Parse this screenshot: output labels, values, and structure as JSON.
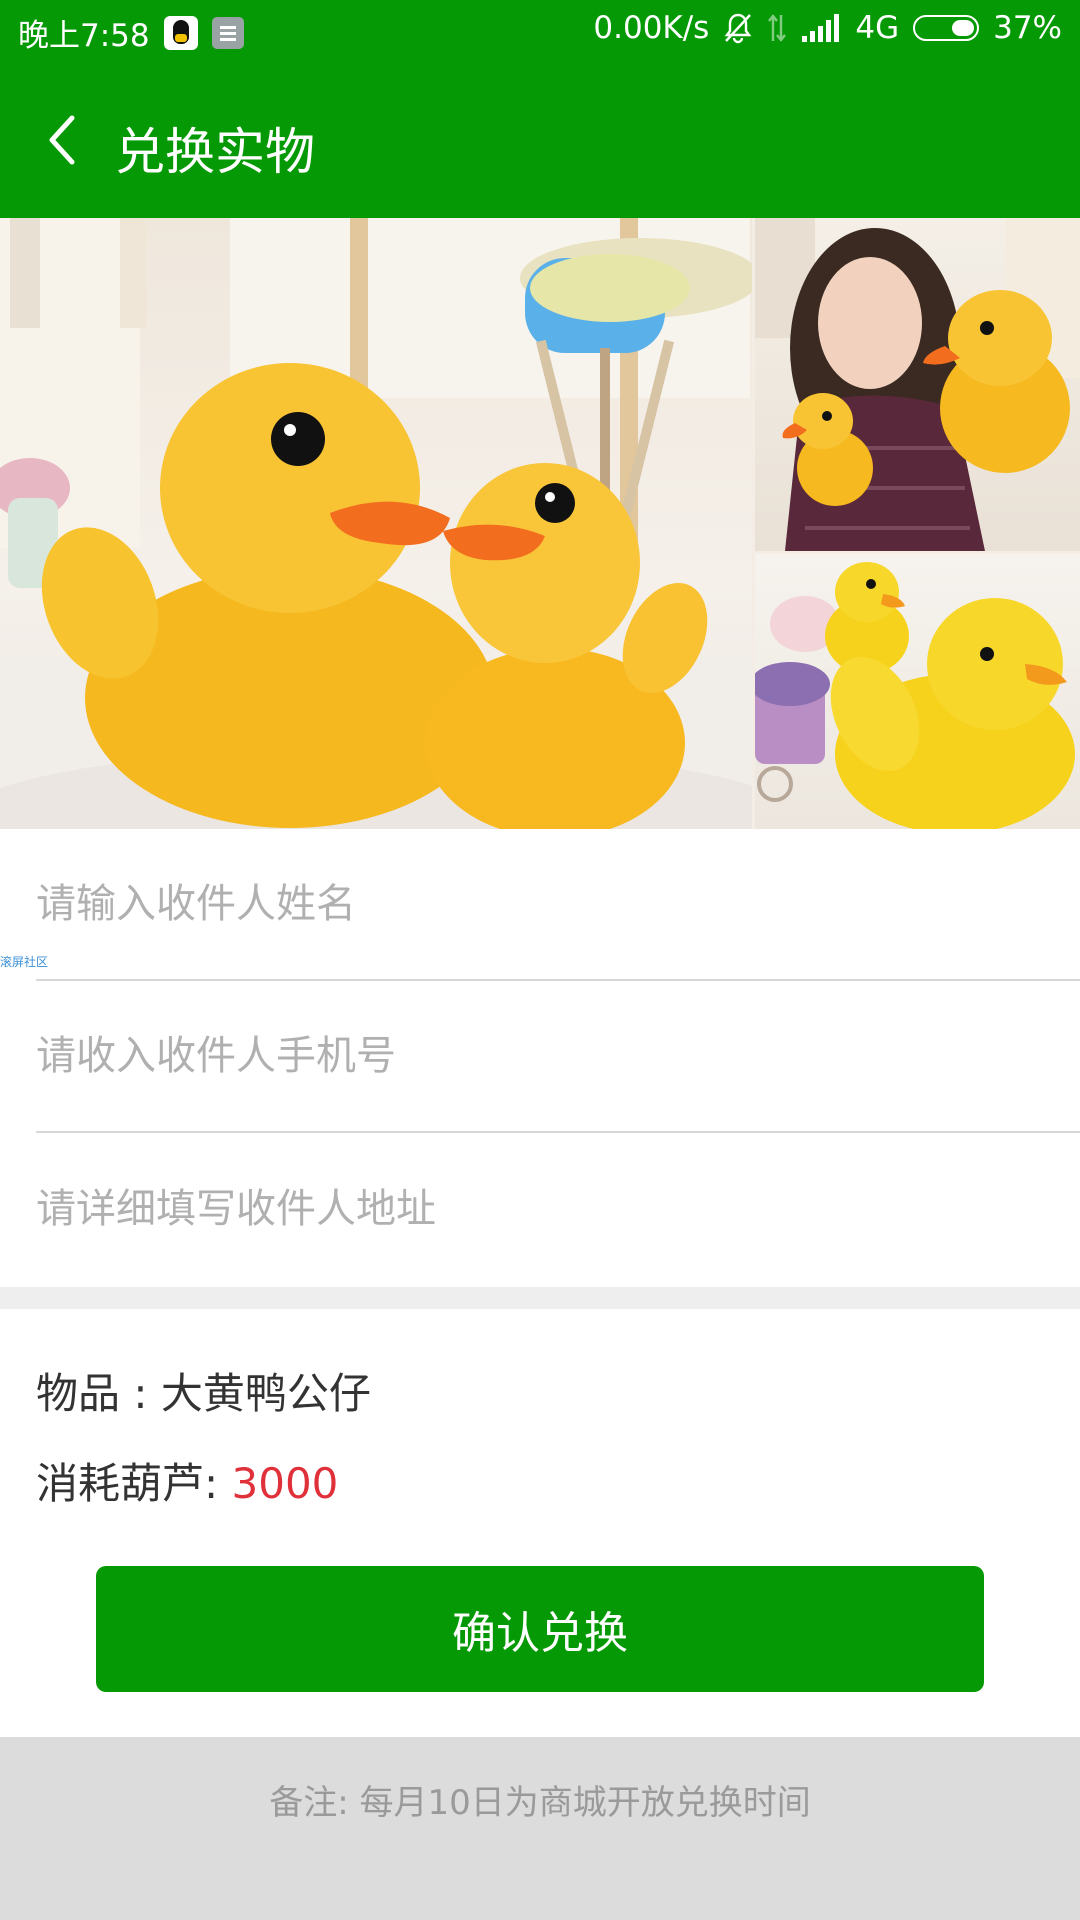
{
  "status_bar": {
    "time": "晚上7:58",
    "network_speed": "0.00K/s",
    "network_type": "4G",
    "battery": "37%",
    "icons": [
      "qq-icon",
      "message-icon",
      "mute-bell-icon",
      "data-arrows-icon",
      "signal-icon",
      "battery-icon"
    ]
  },
  "header": {
    "title": "兑换实物",
    "back_icon": "chevron-left-icon",
    "background": "#059a05"
  },
  "gallery": {
    "images": [
      "two-yellow-duck-plush-photo",
      "girl-holding-duck-plush-photo",
      "stacked-duck-plush-photo"
    ]
  },
  "form": {
    "name_placeholder": "请输入收件人姓名",
    "phone_placeholder": "请收入收件人手机号",
    "address_placeholder": "请详细填写收件人地址"
  },
  "watermark": "滚屏社区",
  "item": {
    "item_label": "物品 : 大黄鸭公仔",
    "cost_label": "消耗葫芦: ",
    "cost_value": "3000",
    "cost_color": "#e0303a"
  },
  "actions": {
    "confirm_label": "确认兑换"
  },
  "footer": {
    "note": "备注: 每月10日为商城开放兑换时间"
  }
}
